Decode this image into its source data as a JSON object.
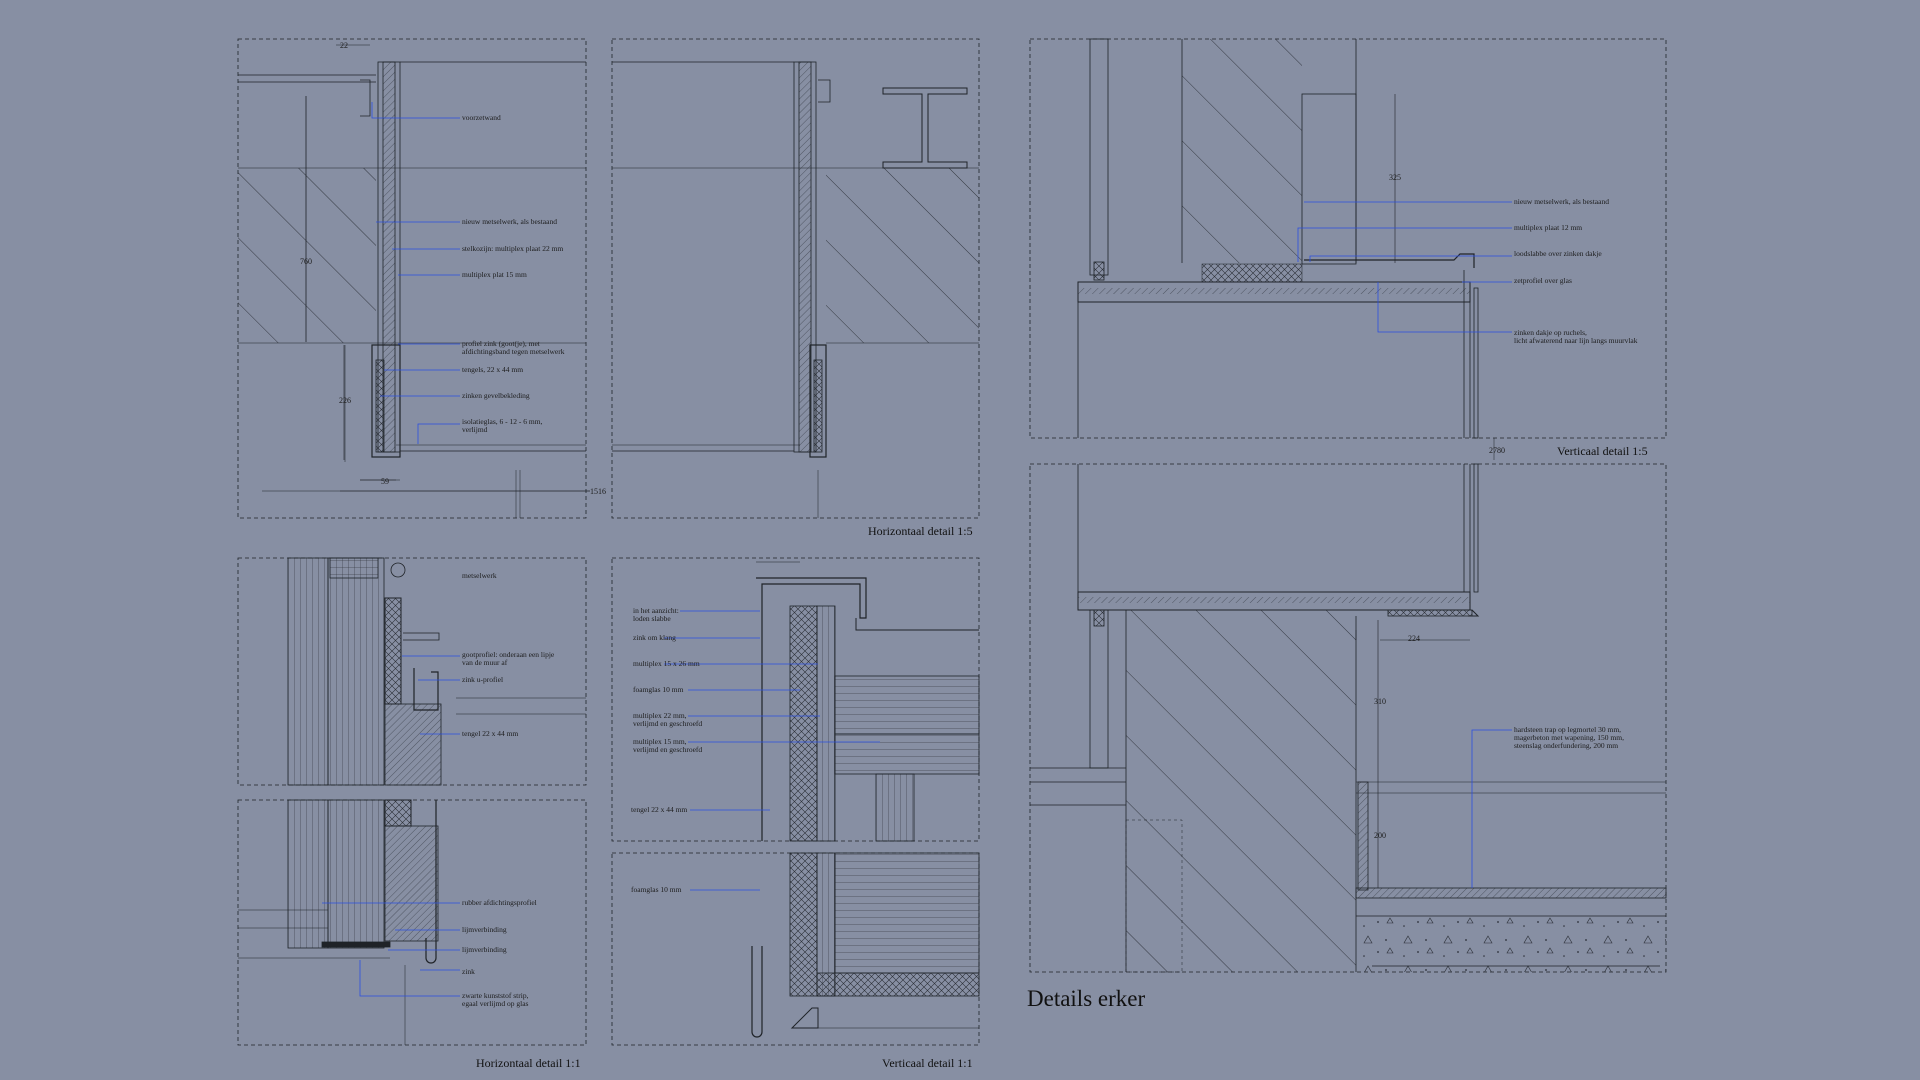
{
  "colors": {
    "background": "#878fa3",
    "line": "#1f2328",
    "leader": "#2b4fe0"
  },
  "sheet_title": "Details erker",
  "captions": {
    "horiz_1_5": "Horizontaal detail 1:5",
    "vert_1_5": "Verticaal detail 1:5",
    "horiz_1_1": "Horizontaal detail 1:1",
    "vert_1_1": "Verticaal detail 1:1"
  },
  "dimensions": {
    "d22": "22",
    "d760": "760",
    "d226": "226",
    "d59": "59",
    "d1516": "1516",
    "d325": "325",
    "d2780": "2780",
    "d224": "224",
    "d310": "310",
    "d200": "200"
  },
  "labels": {
    "voorzetwand": "voorzetwand",
    "metselwerk_nieuw": "nieuw metselwerk, als bestaand",
    "stelkozijn": "stelkozijn: multiplex plaat 22 mm",
    "multiplex15": "multiplex plat 15 mm",
    "profiel_zink": "profiel zink (goot(je), met\nafdichtingsband tegen metselwerk",
    "tengels": "tengels, 22 x 44 mm",
    "zinken_gevel": "zinken gevelbekleding",
    "isolatieglas": "isolatieglas, 6 - 12 - 6 mm,\nverlijmd",
    "metselwerk": "metselwerk",
    "gootprofiel": "gootprofiel: onderaan een lipje\nvan de muur af",
    "zink_u": "zink u-profiel",
    "tengel_22": "tengel 22 x 44 mm",
    "rubber": "rubber afdichtingsprofiel",
    "lijm1": "lijmverbinding",
    "lijm2": "lijmverbinding",
    "zink": "zink",
    "zwarte_strip": "zwarte kunststof strip,\negaal verlijmd op glas",
    "zanzicht": "in het aanzicht:\nloden slabbe",
    "zink_klang": "zink om klang",
    "multiplex_15x26": "multiplex 15 x 26 mm",
    "foamglas10a": "foamglas 10 mm",
    "multiplex22v": "multiplex 22 mm,\nverlijmd en geschroefd",
    "multiplex15v": "multiplex 15 mm,\nverlijmd en geschroefd",
    "tengel_22b": "tengel 22 x 44 mm",
    "foamglas10b": "foamglas 10 mm",
    "r_metselwerk": "nieuw metselwerk, als bestaand",
    "r_multiplex12": "multiplex plaat 12 mm",
    "r_loodslabbe": "loodslabbe over zinken dakje",
    "r_zetprofiel": "zetprofiel over glas",
    "r_zinken_dakje": "zinken dakje op ruchels,\nlicht afwaterend naar lijn langs muurvlak",
    "r_hardsteen": "hardsteen trap op legmortel 30 mm,\nmagerbeton met wapening, 150 mm,\nsteenslag onderfundering, 200 mm"
  }
}
